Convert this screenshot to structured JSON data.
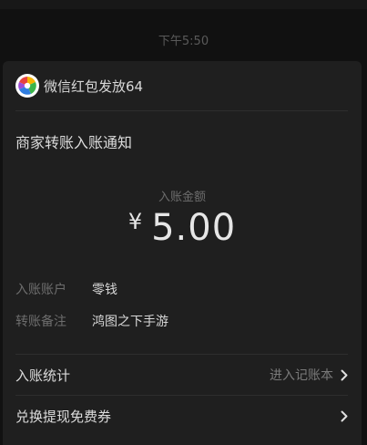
{
  "time_divider": "下午5:50",
  "card": {
    "sender": "微信红包发放64",
    "title": "商家转账入账通知",
    "amount_label": "入账金额",
    "currency": "¥",
    "amount": "5.00",
    "details": [
      {
        "key": "入账账户",
        "value": "零钱"
      },
      {
        "key": "转账备注",
        "value": "鸿图之下手游"
      }
    ],
    "menu": [
      {
        "label": "入账统计",
        "hint": "进入记账本"
      },
      {
        "label": "兑换提现免费券",
        "hint": ""
      }
    ]
  },
  "icons": {
    "logo": "wechat-pay-logo-icon",
    "chevron": "chevron-right-icon"
  },
  "colors": {
    "background": "#111111",
    "card": "#1f1f1f",
    "logo_red": "#e64340",
    "logo_blue": "#2f7de1",
    "logo_green": "#3bb54a",
    "logo_yellow": "#f5b400"
  }
}
